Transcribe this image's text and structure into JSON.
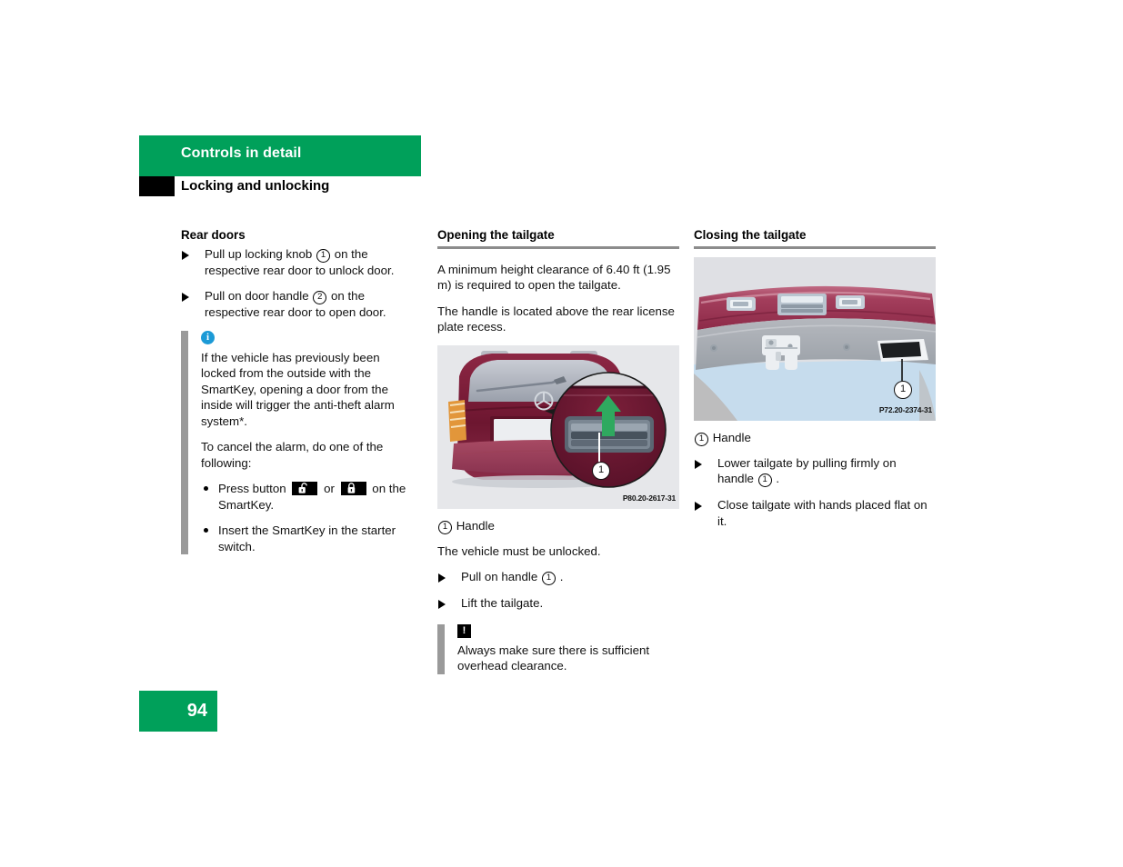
{
  "header": {
    "banner_title": "Controls in detail",
    "section_title": "Locking and unlocking"
  },
  "left_column": {
    "heading": "Rear doors",
    "steps": [
      {
        "before": "Pull up locking knob",
        "num": "1",
        "after": "on the respective rear door to unlock door."
      },
      {
        "before": "Pull on door handle",
        "num": "2",
        "after": "on the respective rear door to open door."
      }
    ],
    "note": {
      "icon": "info-icon",
      "icon_glyph": "i",
      "paragraph1": "If the vehicle has previously been locked from the outside with the SmartKey, opening a door from the inside will trigger the anti-theft alarm system*.",
      "paragraph2": "To cancel the alarm, do one of the following:",
      "bullets": [
        {
          "before": "Press button",
          "badge1": "unlock-padlock-icon",
          "middle": "or",
          "badge2": "lock-padlock-icon",
          "after": "on the SmartKey."
        },
        {
          "text": "Insert the SmartKey in the starter switch."
        }
      ]
    }
  },
  "middle_column": {
    "heading": "Opening the tailgate",
    "paragraph1": "A minimum height clearance of 6.40 ft (1.95 m) is required to open the tailgate.",
    "paragraph2": "The handle is located above the rear license plate recess.",
    "figure": {
      "code": "P80.20-2617-31",
      "callout": "1",
      "alt": "Rear of station wagon with magnified detail of tailgate handle and green upward arrow"
    },
    "legend": {
      "num": "1",
      "label": "Handle"
    },
    "paragraph3": "The vehicle must be unlocked.",
    "steps": [
      {
        "before": "Pull on handle",
        "num": "1",
        "after": "."
      },
      {
        "before": "Lift the tailgate.",
        "num": "",
        "after": ""
      }
    ],
    "warning": {
      "icon": "warning-exclamation-icon",
      "icon_glyph": "!",
      "text": "Always make sure there is sufficient overhead clearance."
    }
  },
  "right_column": {
    "heading": "Closing the tailgate",
    "figure": {
      "code": "P72.20-2374-31",
      "callout": "1",
      "alt": "Underside of open tailgate showing handle recess"
    },
    "legend": {
      "num": "1",
      "label": "Handle"
    },
    "steps": [
      {
        "before": "Lower tailgate by pulling firmly on handle",
        "num": "1",
        "after": "."
      },
      {
        "before": "Close tailgate with hands placed flat on it.",
        "num": "",
        "after": ""
      }
    ]
  },
  "footer": {
    "page_number": "94"
  },
  "colors": {
    "brand_green": "#00A05A",
    "info_blue": "#1c9ad6",
    "rule_gray": "#8c8c8c",
    "note_bar_gray": "#9a9a9a",
    "arrow_green": "#2FA95F",
    "car_body_red": "#7d1f38"
  }
}
